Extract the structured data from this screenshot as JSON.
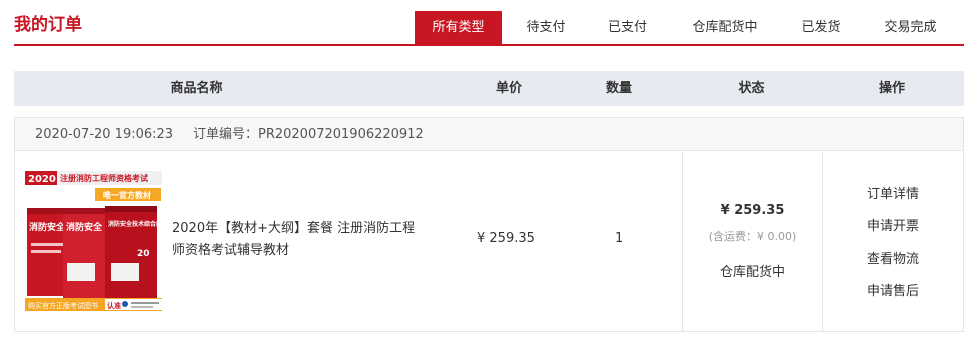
{
  "header": {
    "title": "我的订单",
    "tabs": [
      {
        "label": "所有类型",
        "active": true
      },
      {
        "label": "待支付",
        "active": false
      },
      {
        "label": "已支付",
        "active": false
      },
      {
        "label": "仓库配货中",
        "active": false
      },
      {
        "label": "已发货",
        "active": false
      },
      {
        "label": "交易完成",
        "active": false
      }
    ]
  },
  "table": {
    "columns": [
      "商品名称",
      "单价",
      "数量",
      "状态",
      "操作"
    ]
  },
  "order": {
    "date": "2020-07-20 19:06:23",
    "order_no": "订单编号：PR20200720190622091​2",
    "product": {
      "name": "2020年【教材+大纲】套餐 注册消防工程师资格考试辅导教材",
      "cover": {
        "year": "2020",
        "banner": "注册消防工程师资格考试",
        "tag": "唯一官方教材",
        "book_title": "消防安全",
        "book_title_3": "消防安全技术综合能力",
        "footer": "购买官方正版考试图书",
        "badge": "认准"
      }
    },
    "unit_price": "¥ 259.35",
    "quantity": "1",
    "total": "¥ 259.35",
    "freight": "(含运费：¥ 0.00)",
    "status": "仓库配货中",
    "actions": [
      "订单详情",
      "申请开票",
      "查看物流",
      "申请售后"
    ]
  },
  "colors": {
    "brand_red": "#c81623",
    "header_bg": "#e8eaf1"
  }
}
